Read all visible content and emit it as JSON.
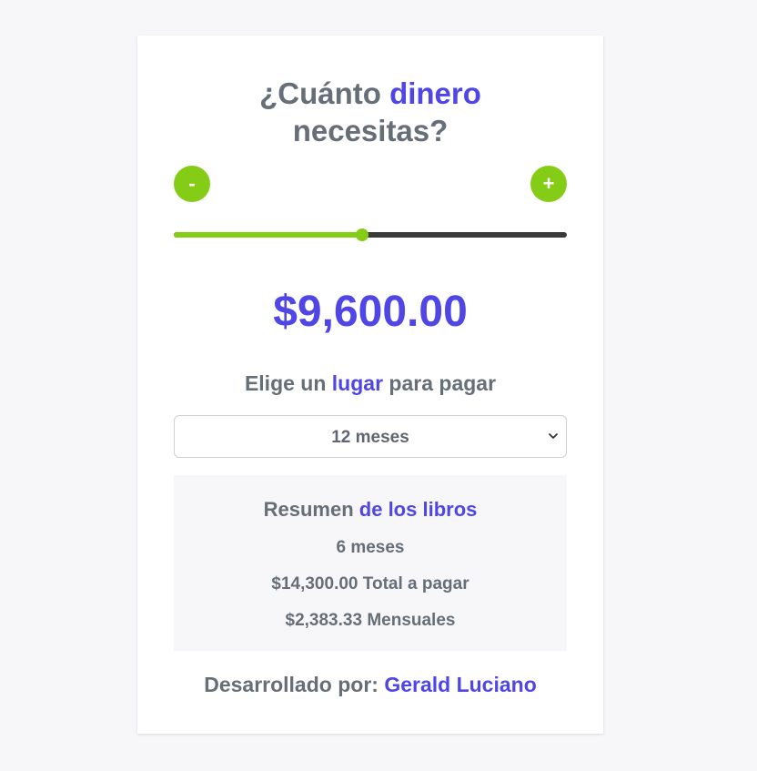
{
  "header": {
    "title_part1": "¿Cuánto ",
    "title_accent": "dinero",
    "title_part2": "necesitas?"
  },
  "controls": {
    "minus_label": "-",
    "plus_label": "+"
  },
  "slider": {
    "value_fraction": 0.48,
    "fill_color": "#84cc16",
    "track_color": "#3a3a3a"
  },
  "amount": {
    "display": "$9,600.00"
  },
  "payment": {
    "prompt_part1": "Elige un ",
    "prompt_accent": "lugar",
    "prompt_part2": " para pagar",
    "select_value": "12 meses"
  },
  "summary": {
    "title_part1": "Resumen ",
    "title_accent": "de los libros",
    "months": "6 meses",
    "total": "$14,300.00 Total a pagar",
    "monthly": "$2,383.33 Mensuales"
  },
  "footer": {
    "label": "Desarrollado por: ",
    "author": "Gerald Luciano"
  },
  "colors": {
    "accent": "#4f46e5",
    "button": "#84cc16",
    "text": "#666e78"
  }
}
